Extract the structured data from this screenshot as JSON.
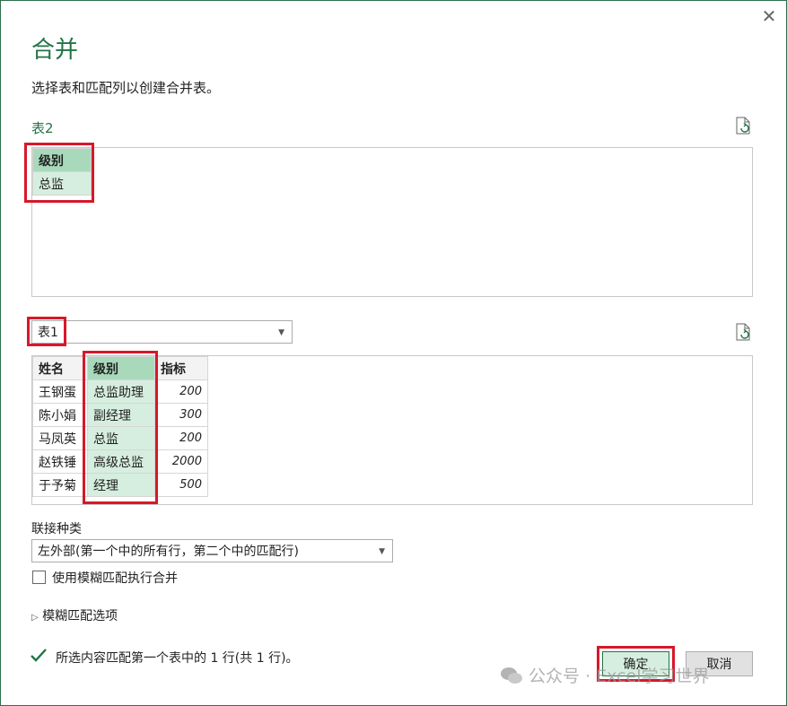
{
  "dialog": {
    "title": "合并",
    "subtitle": "选择表和匹配列以创建合并表。",
    "close_glyph": "✕"
  },
  "table2": {
    "label": "表2",
    "columns": [
      "级别"
    ],
    "rows": [
      [
        "总监"
      ]
    ]
  },
  "table1": {
    "selected": "表1",
    "columns": [
      "姓名",
      "级别",
      "指标"
    ],
    "rows": [
      [
        "王钢蛋",
        "总监助理",
        "200"
      ],
      [
        "陈小娟",
        "副经理",
        "300"
      ],
      [
        "马凤英",
        "总监",
        "200"
      ],
      [
        "赵铁锤",
        "高级总监",
        "2000"
      ],
      [
        "于予菊",
        "经理",
        "500"
      ]
    ]
  },
  "join": {
    "label": "联接种类",
    "selected": "左外部(第一个中的所有行，第二个中的匹配行)"
  },
  "fuzzy": {
    "checkbox_label": "使用模糊匹配执行合并",
    "checked": false,
    "options_label": "模糊匹配选项"
  },
  "status": {
    "message": "所选内容匹配第一个表中的 1 行(共 1 行)。"
  },
  "buttons": {
    "ok": "确定",
    "cancel": "取消"
  },
  "watermark": "公众号 · Excel学习世界",
  "colors": {
    "accent": "#217346",
    "highlight": "#d6eedf",
    "annotation_red": "#d7182a"
  }
}
